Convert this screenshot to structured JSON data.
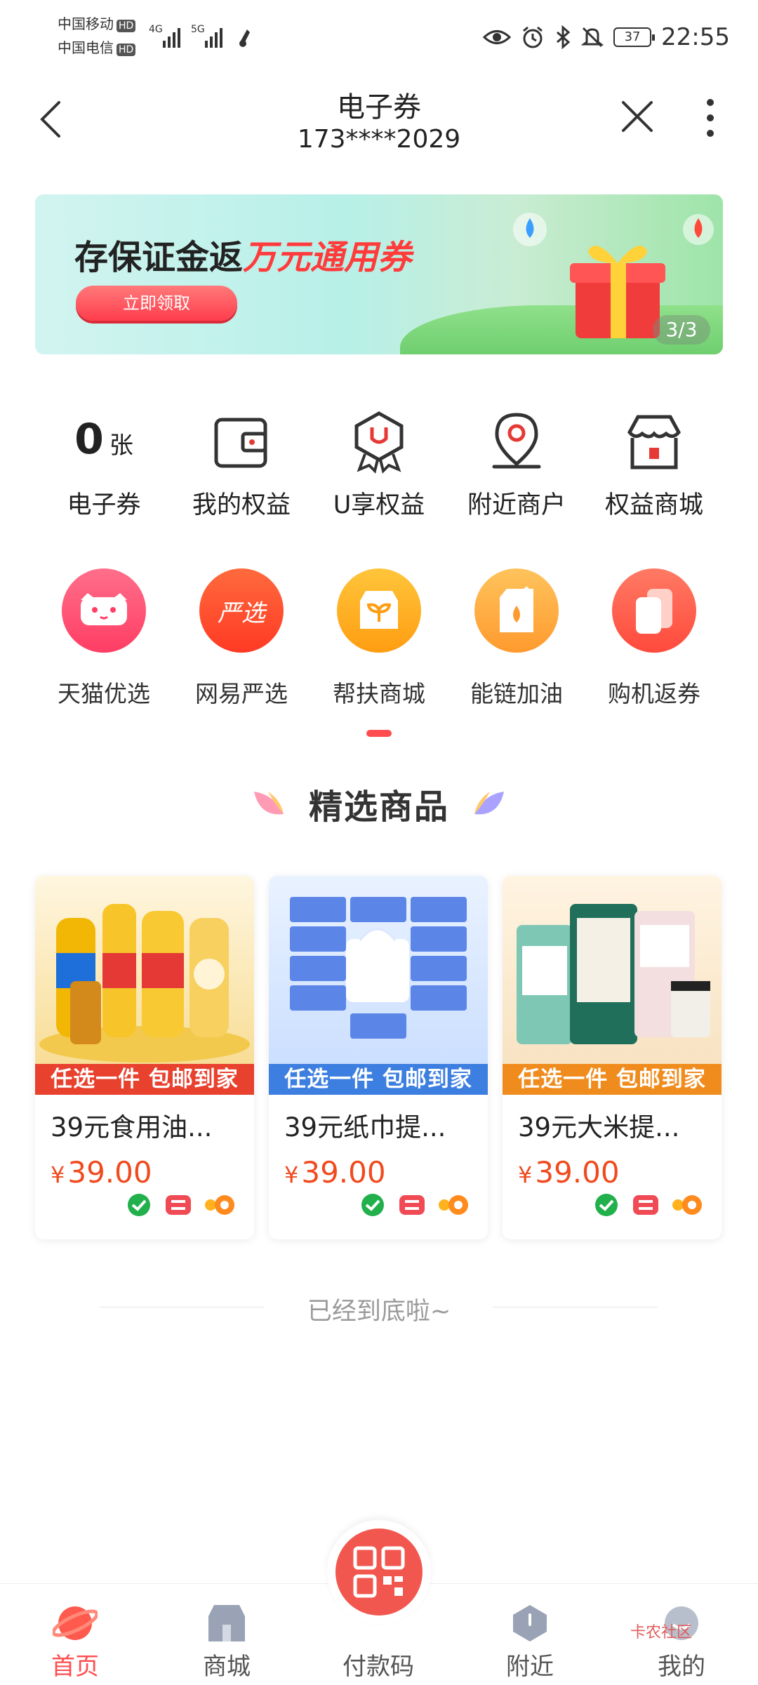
{
  "status_bar": {
    "carrier1": "中国移动",
    "carrier2": "中国电信",
    "hd": "HD",
    "net1": "4G",
    "net2": "5G",
    "battery": "37",
    "time": "22:55"
  },
  "header": {
    "title": "电子券",
    "subtitle": "173****2029"
  },
  "banner": {
    "title_prefix": "存保证金返",
    "title_highlight": "万元通用券",
    "button": "立即领取",
    "page": "3/3"
  },
  "quick": {
    "count": "0",
    "count_unit": "张",
    "items": [
      {
        "label": "电子券"
      },
      {
        "label": "我的权益"
      },
      {
        "label": "U享权益"
      },
      {
        "label": "附近商户"
      },
      {
        "label": "权益商城"
      }
    ]
  },
  "apps": {
    "items": [
      {
        "label": "天猫优选",
        "icon": "tmall-cat-icon",
        "color": "#ff4d6d"
      },
      {
        "label": "网易严选",
        "icon": "netease-yanxuan-icon",
        "icon_text": "严选",
        "color": "#ff4b2b"
      },
      {
        "label": "帮扶商城",
        "icon": "sprout-shop-icon",
        "color": "#ffa41c"
      },
      {
        "label": "能链加油",
        "icon": "fuel-can-icon",
        "color": "#ffa93a"
      },
      {
        "label": "购机返券",
        "icon": "phone-coupon-icon",
        "color": "#ff5a4e"
      }
    ]
  },
  "section": {
    "title": "精选商品"
  },
  "products": [
    {
      "name": "39元食用油...",
      "currency": "¥",
      "price": "39.00",
      "tag": "任选一件 包邮到家",
      "tag_color": "#e8412e"
    },
    {
      "name": "39元纸巾提...",
      "currency": "¥",
      "price": "39.00",
      "tag": "任选一件 包邮到家",
      "tag_color": "#3d7fe0"
    },
    {
      "name": "39元大米提...",
      "currency": "¥",
      "price": "39.00",
      "tag": "任选一件 包邮到家",
      "tag_color": "#f08c1e"
    }
  ],
  "footer_text": "已经到底啦~",
  "tabbar": {
    "tabs": [
      {
        "label": "首页"
      },
      {
        "label": "商城"
      },
      {
        "label": "付款码"
      },
      {
        "label": "附近"
      },
      {
        "label": "我的"
      }
    ]
  },
  "watermark": "卡农社区",
  "colors": {
    "accent": "#ff4d4f",
    "price": "#f04a1e"
  }
}
